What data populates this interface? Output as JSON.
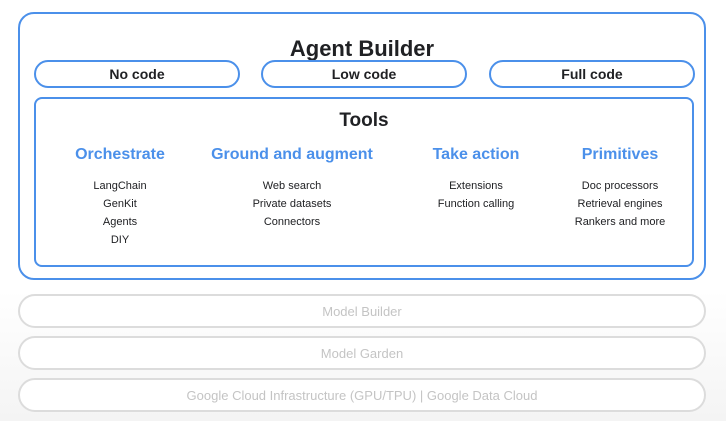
{
  "agent_builder": {
    "title": "Agent Builder",
    "modes": [
      "No code",
      "Low code",
      "Full code"
    ]
  },
  "tools": {
    "title": "Tools",
    "columns": [
      {
        "heading": "Orchestrate",
        "items": [
          "LangChain",
          "GenKit",
          "Agents",
          "DIY"
        ]
      },
      {
        "heading": "Ground and augment",
        "items": [
          "Web search",
          "Private datasets",
          "Connectors"
        ]
      },
      {
        "heading": "Take action",
        "items": [
          "Extensions",
          "Function calling"
        ]
      },
      {
        "heading": "Primitives",
        "items": [
          "Doc processors",
          "Retrieval engines",
          "Rankers and more"
        ]
      }
    ]
  },
  "layers": [
    "Model Builder",
    "Model Garden",
    "Google Cloud Infrastructure (GPU/TPU) | Google Data Cloud"
  ],
  "colors": {
    "accent": "#4b90ea",
    "text": "#202124",
    "faded_border": "#dcdcdc",
    "faded_text": "#c4c4c4"
  }
}
